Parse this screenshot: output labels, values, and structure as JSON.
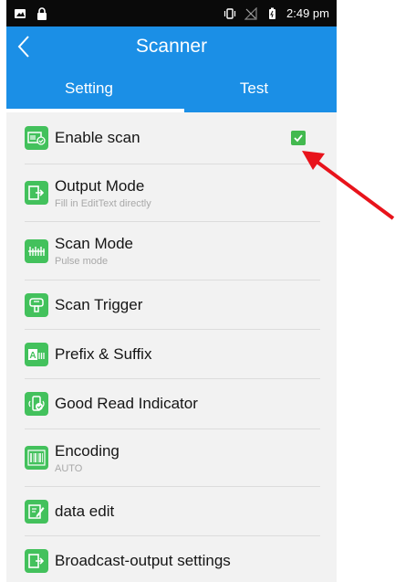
{
  "status_bar": {
    "time": "2:49 pm",
    "icons": [
      "image-icon",
      "lock-icon",
      "vibrate-icon",
      "no-signal-icon",
      "battery-icon"
    ]
  },
  "app_bar": {
    "title": "Scanner",
    "back_icon": "back-chevron-icon"
  },
  "tabs": [
    {
      "label": "Setting",
      "active": true
    },
    {
      "label": "Test",
      "active": false
    }
  ],
  "settings": [
    {
      "title": "Enable scan",
      "subtitle": "",
      "icon": "scan-check-icon",
      "checked": true
    },
    {
      "title": "Output Mode",
      "subtitle": "Fill in EditText directly",
      "icon": "output-icon"
    },
    {
      "title": "Scan Mode",
      "subtitle": "Pulse mode",
      "icon": "scan-mode-icon"
    },
    {
      "title": "Scan Trigger",
      "subtitle": "",
      "icon": "trigger-icon"
    },
    {
      "title": "Prefix & Suffix",
      "subtitle": "",
      "icon": "prefix-suffix-icon"
    },
    {
      "title": "Good Read Indicator",
      "subtitle": "",
      "icon": "good-read-icon"
    },
    {
      "title": "Encoding",
      "subtitle": "AUTO",
      "icon": "barcode-icon"
    },
    {
      "title": "data edit",
      "subtitle": "",
      "icon": "edit-icon"
    },
    {
      "title": "Broadcast-output settings",
      "subtitle": "",
      "icon": "broadcast-output-icon"
    }
  ],
  "colors": {
    "accent": "#1b8fe6",
    "icon_green": "#43c15c",
    "annotation_arrow": "#e8131b"
  }
}
